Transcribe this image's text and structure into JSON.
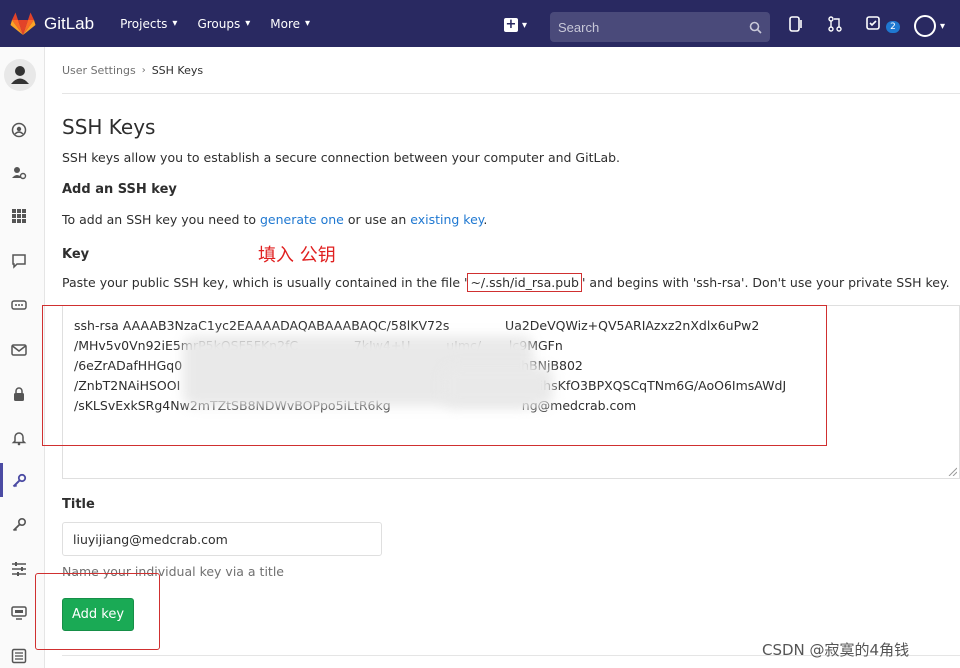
{
  "app": {
    "name": "GitLab",
    "brand_color": "#292961",
    "accent": "#1f78d1",
    "success": "#1aaa55"
  },
  "nav": {
    "items": [
      {
        "label": "Projects"
      },
      {
        "label": "Groups"
      },
      {
        "label": "More"
      }
    ],
    "search_placeholder": "Search",
    "todo_count": "2"
  },
  "breadcrumb": {
    "parent": "User Settings",
    "current": "SSH Keys"
  },
  "page": {
    "title": "SSH Keys",
    "description": "SSH keys allow you to establish a secure connection between your computer and GitLab.",
    "add_title": "Add an SSH key",
    "add_desc_pre": "To add an SSH key you need to ",
    "add_desc_link1": "generate one",
    "add_desc_mid": " or use an ",
    "add_desc_link2": "existing key",
    "add_desc_post": "."
  },
  "key_field": {
    "label": "Key",
    "annotation": "填入 公钥",
    "help_pre": "Paste your public SSH key, which is usually contained in the file '",
    "help_file": "~/.ssh/id_rsa.pub",
    "help_post": "' and begins with 'ssh-rsa'. Don't use your private SSH key.",
    "value_lines": [
      "ssh-rsa AAAAB3NzaC1yc2EAAAADAQABAAABAQC/58lKV72s              Ua2DeVQWiz+QV5ARIAzxz2nXdlx6uPw2",
      "/MHv5v0Vn92iE5mrP5kOSF5FKn2fC              7kJw4+U         uJmc/       lc9MGFn",
      "/6eZrADafHHGq0         RfyljxhXH0U                         C      MvanJr7       x0hBNjB802",
      "/ZnbT2NAiHSOOI                                             Ysy1        dORo7kPbU      onzihsKfO3BPXQSCqTNm6G/AoO6ImsAWdJ",
      "/sKLSvExkSRg4Nw2mTZtSB8NDWvBOPpo5iLtR6kg                                 ng@medcrab.com"
    ]
  },
  "title_field": {
    "label": "Title",
    "value": "liuyijiang@medcrab.com",
    "help": "Name your individual key via a title"
  },
  "submit": {
    "label": "Add key"
  },
  "watermark": "CSDN @寂寞的4角钱"
}
